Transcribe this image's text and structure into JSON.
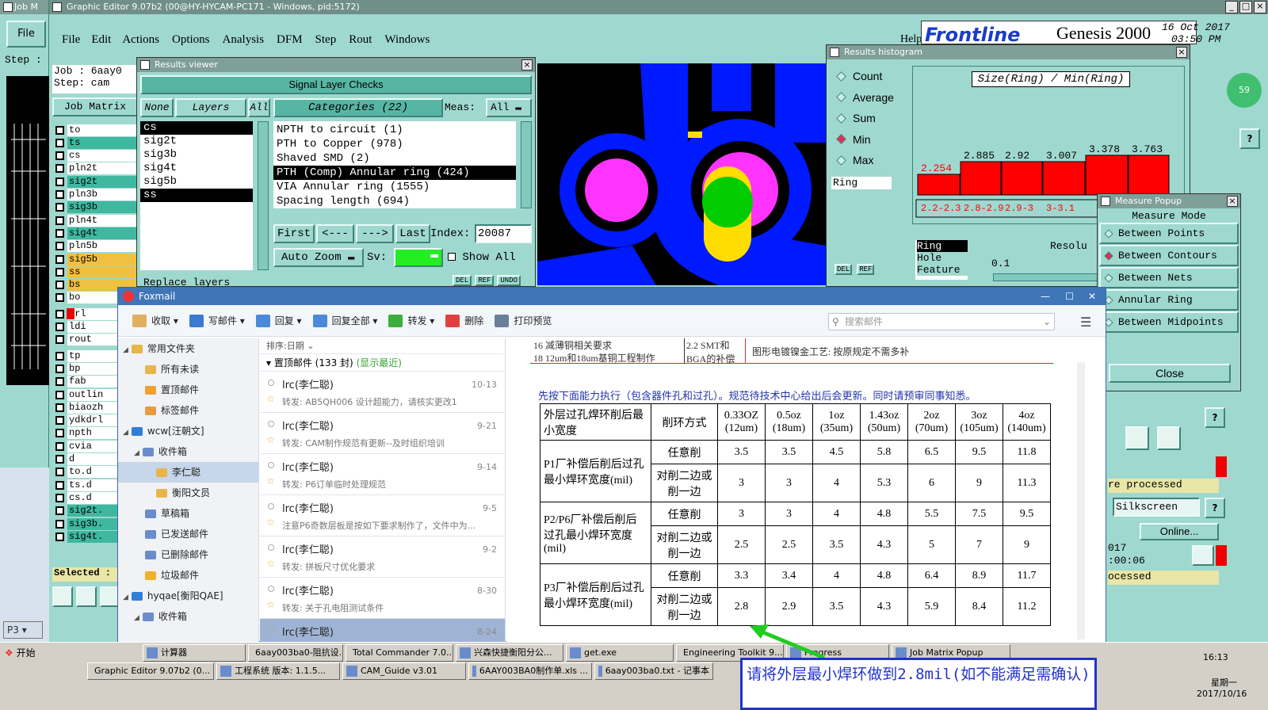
{
  "job_matrix_win": {
    "title": "Job M"
  },
  "editor": {
    "title": "Graphic Editor 9.07b2 (00@HY-HYCAM-PC171 - Windows, pid:5172)",
    "menu": [
      "File",
      "Edit",
      "Actions",
      "Options",
      "Analysis",
      "DFM",
      "Step",
      "Rout",
      "Windows"
    ],
    "help": "Help",
    "brand": "Frontline",
    "product": "Genesis 2000",
    "date": "16 Oct 2017",
    "time": "03:50 PM"
  },
  "left_panel": {
    "file_label": "File",
    "step_label": "Step :",
    "job_line": "Job :  6aay0",
    "step_line": "Step:  cam",
    "job_matrix_btn": "Job Matrix",
    "layers": [
      "to",
      "ts",
      "cs",
      "pln2t",
      "sig2t",
      "pln3b",
      "sig3b",
      "pln4t",
      "sig4t",
      "pln5b",
      "sig5b",
      "ss",
      "bs",
      "bo",
      "drl",
      "ldi",
      "rout",
      "tp",
      "bp",
      "fab",
      "outlin",
      "biaozh",
      "ydkdrl",
      "npth",
      "cvia",
      "d",
      "to.d",
      "ts.d",
      "cs.d",
      "sig2t.",
      "sig3b.",
      "sig4t."
    ],
    "selected_label": "Selected :",
    "p3_label": "P3"
  },
  "results_viewer": {
    "title": "Results viewer",
    "header": "Signal Layer Checks",
    "none_btn": "None",
    "layers_btn": "Layers",
    "all_btn": "All",
    "categories_btn": "Categories (22)",
    "meas_label": "Meas:",
    "meas_value": "All",
    "layer_list": [
      "cs",
      "sig2t",
      "sig3b",
      "sig4t",
      "sig5b",
      "ss"
    ],
    "categories": [
      "NPTH to circuit (1)",
      "PTH to Copper (978)",
      "Shaved SMD (2)",
      "PTH (Comp) Annular ring (424)",
      "VIA Annular ring (1555)",
      "Spacing length (694)"
    ],
    "nav": [
      "First",
      "<---",
      "--->",
      "Last"
    ],
    "index_label": "Index:",
    "index_value": "20087",
    "auto_zoom": "Auto Zoom",
    "sv_label": "Sv:",
    "show_all": "Show All",
    "replace_layers": "Replace layers",
    "small_btns": [
      "DEL",
      "REF",
      "UNDO"
    ]
  },
  "histogram": {
    "title": "Results histogram",
    "options": [
      "Count",
      "Average",
      "Sum",
      "Min",
      "Max"
    ],
    "selected_option": "Min",
    "chart_title": "Size(Ring) / Min(Ring)",
    "field": "Ring",
    "values": [
      "2.254",
      "2.885",
      "2.92",
      "3.007",
      "3.378",
      "3.763"
    ],
    "ranges": [
      "2.2-2.3",
      "2.8-2.9",
      "2.9-3",
      "3-3.1"
    ],
    "list": [
      "Ring",
      "Hole",
      "Feature"
    ],
    "resolution_label": "Resolu",
    "resolution_value": "0.1",
    "small_btns": [
      "DEL",
      "REF"
    ]
  },
  "measure_popup": {
    "title": "Measure Popup",
    "mode_label": "Measure Mode",
    "modes": [
      "Between Points",
      "Between Contours",
      "Between Nets",
      "Annular Ring",
      "Between Midpoints"
    ],
    "selected_mode": "Between Contours",
    "close": "Close"
  },
  "right_strip": {
    "processed1": "re processed",
    "silkscreen": "Silkscreen",
    "online": "Online...",
    "year_frag": "017",
    "time_frag": ":00:06",
    "processed2": "ocessed",
    "badge": "59"
  },
  "foxmail": {
    "title": "Foxmail",
    "toolbar": [
      "收取",
      "写邮件",
      "回复",
      "回复全部",
      "转发",
      "删除",
      "打印预览"
    ],
    "search_placeholder": "搜索邮件",
    "folders": [
      {
        "label": "常用文件夹",
        "level": 0
      },
      {
        "label": "所有未读",
        "level": 1
      },
      {
        "label": "置顶邮件",
        "level": 1
      },
      {
        "label": "标签邮件",
        "level": 1
      },
      {
        "label": "wcw[汪朝文]",
        "level": 0
      },
      {
        "label": "收件箱",
        "level": 1
      },
      {
        "label": "李仁聪",
        "level": 2
      },
      {
        "label": "衡阳文员",
        "level": 2
      },
      {
        "label": "草稿箱",
        "level": 1
      },
      {
        "label": "已发送邮件",
        "level": 1
      },
      {
        "label": "已删除邮件",
        "level": 1
      },
      {
        "label": "垃圾邮件",
        "level": 1
      },
      {
        "label": "hyqae[衡阳QAE]",
        "level": 0
      },
      {
        "label": "收件箱",
        "level": 1
      }
    ],
    "sort_label": "排序:日期",
    "pinned_header": "置顶邮件 (133 封)",
    "pinned_recent": "(显示最近)",
    "mails": [
      {
        "from": "lrc(李仁聪)",
        "date": "10-13",
        "subject": "转发: AB5QH006  设计超能力，请核实更改1"
      },
      {
        "from": "lrc(李仁聪)",
        "date": "9-21",
        "subject": "转发: CAM制作规范有更新--及时组织培训"
      },
      {
        "from": "lrc(李仁聪)",
        "date": "9-14",
        "subject": "转发: P6订单临时处理规范"
      },
      {
        "from": "lrc(李仁聪)",
        "date": "9-5",
        "subject": "注意P6奇数层板是按如下要求制作了，文件中为..."
      },
      {
        "from": "lrc(李仁聪)",
        "date": "9-2",
        "subject": "转发: 拼板尺寸优化要求"
      },
      {
        "from": "lrc(李仁聪)",
        "date": "8-30",
        "subject": "转发: 关于孔电阻测试条件"
      },
      {
        "from": "lrc(李仁聪)",
        "date": "8-24",
        "subject": ""
      }
    ],
    "reading": {
      "line1": "16  减薄铜相关要求",
      "line2": "18  12um和18um基铜工程制作",
      "col_b1": "2.2 SMT和",
      "col_b2": "BGA的补偿",
      "col_c": "图形电镀镍金工艺: 按原规定不需多补",
      "intro": "先按下面能力执行（包含器件孔和过孔）。规范待技术中心给出后会更新。同时请预审同事知悉。",
      "table": {
        "head_label": "外层过孔焊环削后最小宽度",
        "head_method": "削环方式",
        "cols": [
          "0.33OZ (12um)",
          "0.5oz (18um)",
          "1oz (35um)",
          "1.43oz (50um)",
          "2oz (70um)",
          "3oz (105um)",
          "4oz (140um)"
        ],
        "groups": [
          {
            "label": "P1厂补偿后削后过孔最小焊环宽度(mil)",
            "rows": [
              {
                "method": "任意削",
                "values": [
                  "3.5",
                  "3.5",
                  "4.5",
                  "5.8",
                  "6.5",
                  "9.5",
                  "11.8"
                ]
              },
              {
                "method": "对削二边或削一边",
                "values": [
                  "3",
                  "3",
                  "4",
                  "5.3",
                  "6",
                  "9",
                  "11.3"
                ]
              }
            ]
          },
          {
            "label": "P2/P6厂补偿后削后过孔最小焊环宽度(mil)",
            "rows": [
              {
                "method": "任意削",
                "values": [
                  "3",
                  "3",
                  "4",
                  "4.8",
                  "5.5",
                  "7.5",
                  "9.5"
                ]
              },
              {
                "method": "对削二边或削一边",
                "values": [
                  "2.5",
                  "2.5",
                  "3.5",
                  "4.3",
                  "5",
                  "7",
                  "9"
                ]
              }
            ]
          },
          {
            "label": "P3厂补偿后削后过孔最小焊环宽度(mil)",
            "rows": [
              {
                "method": "任意削",
                "values": [
                  "3.3",
                  "3.4",
                  "4",
                  "4.8",
                  "6.4",
                  "8.9",
                  "11.7"
                ]
              },
              {
                "method": "对削二边或削一边",
                "values": [
                  "2.8",
                  "2.9",
                  "3.5",
                  "4.3",
                  "5.9",
                  "8.4",
                  "11.2"
                ]
              }
            ]
          }
        ]
      }
    }
  },
  "annotation": "请将外层最小焊环做到2.8mil(如不能满足需确认)",
  "taskbar": {
    "start": "开始",
    "row1": [
      "计算器",
      "6aay003ba0-阻抗设...",
      "Total Commander 7.0...",
      "兴森快捷衡阳分公...",
      "get.exe",
      "Engineering Toolkit 9....",
      "Progress",
      "Job Matrix Popup"
    ],
    "row2": [
      "Graphic Editor 9.07b2 (0...",
      "工程系统  版本: 1.1.5...",
      "CAM_Guide v3.01",
      "6AAY003BA0制作单.xls ...",
      "6aay003ba0.txt - 记事本"
    ],
    "clock": "16:13",
    "weekday": "星期一",
    "date": "2017/10/16"
  },
  "colors": {
    "motif_bg": "#58b9a6",
    "panel": "#9fd8cf",
    "foxmail_bar": "#3f76b8",
    "accent_red": "#ff0000",
    "annotation_green": "#22cc22"
  }
}
